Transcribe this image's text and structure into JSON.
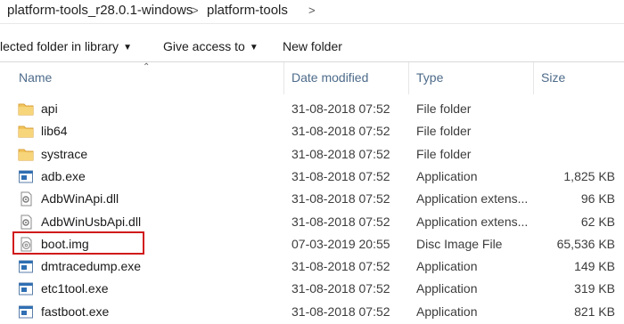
{
  "breadcrumb": {
    "items": [
      "platform-tools_r28.0.1-windows",
      "platform-tools"
    ],
    "separator": ">"
  },
  "toolbar": {
    "include_label": "lected folder in library",
    "share_label": "Give access to",
    "new_folder_label": "New folder"
  },
  "columns": {
    "name": "Name",
    "date": "Date modified",
    "type": "Type",
    "size": "Size"
  },
  "files": [
    {
      "name": "api",
      "date": "31-08-2018 07:52",
      "type": "File folder",
      "size": "",
      "icon": "folder-icon"
    },
    {
      "name": "lib64",
      "date": "31-08-2018 07:52",
      "type": "File folder",
      "size": "",
      "icon": "folder-icon"
    },
    {
      "name": "systrace",
      "date": "31-08-2018 07:52",
      "type": "File folder",
      "size": "",
      "icon": "folder-icon"
    },
    {
      "name": "adb.exe",
      "date": "31-08-2018 07:52",
      "type": "Application",
      "size": "1,825 KB",
      "icon": "application-icon"
    },
    {
      "name": "AdbWinApi.dll",
      "date": "31-08-2018 07:52",
      "type": "Application extens...",
      "size": "96 KB",
      "icon": "dll-icon"
    },
    {
      "name": "AdbWinUsbApi.dll",
      "date": "31-08-2018 07:52",
      "type": "Application extens...",
      "size": "62 KB",
      "icon": "dll-icon"
    },
    {
      "name": "boot.img",
      "date": "07-03-2019 20:55",
      "type": "Disc Image File",
      "size": "65,536 KB",
      "icon": "disc-image-icon"
    },
    {
      "name": "dmtracedump.exe",
      "date": "31-08-2018 07:52",
      "type": "Application",
      "size": "149 KB",
      "icon": "application-icon"
    },
    {
      "name": "etc1tool.exe",
      "date": "31-08-2018 07:52",
      "type": "Application",
      "size": "319 KB",
      "icon": "application-icon"
    },
    {
      "name": "fastboot.exe",
      "date": "31-08-2018 07:52",
      "type": "Application",
      "size": "821 KB",
      "icon": "application-icon"
    }
  ],
  "colors": {
    "highlight": "#d11a1a",
    "folder": "#f2c55c",
    "header_text": "#4d6b8a"
  }
}
